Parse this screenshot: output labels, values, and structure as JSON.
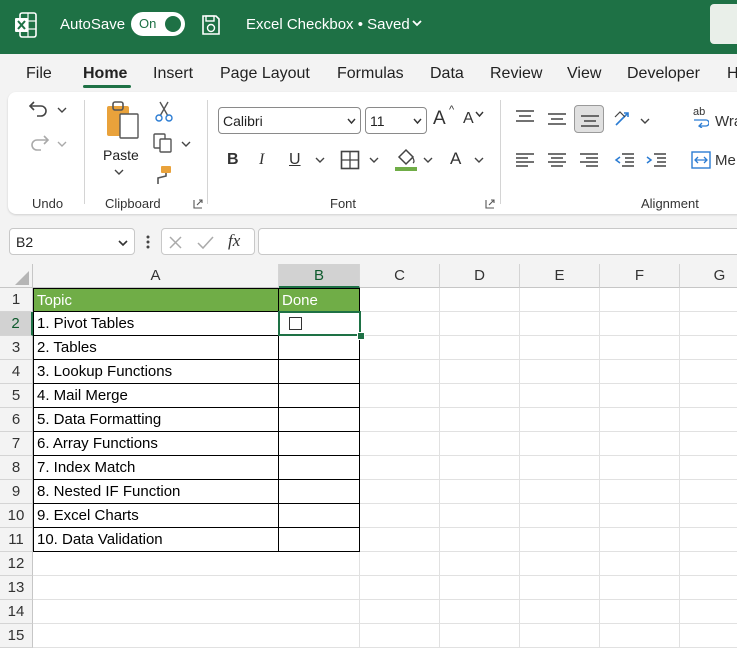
{
  "titlebar": {
    "autosave_label": "AutoSave",
    "autosave_state": "On",
    "document_title": "Excel Checkbox • Saved",
    "colors": {
      "background": "#1e7145",
      "text": "#ffffff"
    }
  },
  "tabs": [
    "File",
    "Home",
    "Insert",
    "Page Layout",
    "Formulas",
    "Data",
    "Review",
    "View",
    "Developer",
    "H"
  ],
  "active_tab": "Home",
  "ribbon": {
    "undo_group": {
      "label": "Undo",
      "icons": [
        "undo-icon",
        "redo-icon"
      ]
    },
    "clipboard_group": {
      "label": "Clipboard",
      "paste_label": "Paste",
      "icons": [
        "paste-icon",
        "cut-icon",
        "copy-icon",
        "format-painter-icon"
      ]
    },
    "font_group": {
      "label": "Font",
      "font_name": "Calibri",
      "font_size": "11",
      "grow_font": "A",
      "shrink_font": "A",
      "bold": "B",
      "italic": "I",
      "underline": "U",
      "font_color": "A",
      "fill_color": "#70ad47",
      "font_color_bar": "#c00000"
    },
    "alignment_group": {
      "label": "Alignment",
      "wrap_label": "Wra",
      "merge_label": "Me",
      "wrap_icon_text": "ab"
    }
  },
  "formula_bar": {
    "name_box": "B2",
    "fx": "fx",
    "formula": ""
  },
  "sheet": {
    "columns": [
      "A",
      "B",
      "C",
      "D",
      "E",
      "F",
      "G"
    ],
    "rows": [
      "1",
      "2",
      "3",
      "4",
      "5",
      "6",
      "7",
      "8",
      "9",
      "10",
      "11",
      "12",
      "13",
      "14",
      "15"
    ],
    "selected_cell": "B2",
    "header_fill": "#70ad47",
    "headers": {
      "a": "Topic",
      "b": "Done"
    },
    "topics": [
      "1. Pivot Tables",
      "2. Tables",
      "3. Lookup Functions",
      "4. Mail Merge",
      "5. Data Formatting",
      "6. Array Functions",
      "7. Index Match",
      "8. Nested IF Function",
      "9. Excel Charts",
      "10. Data Validation"
    ],
    "done_checkbox": {
      "row": "2",
      "checked": false
    }
  }
}
